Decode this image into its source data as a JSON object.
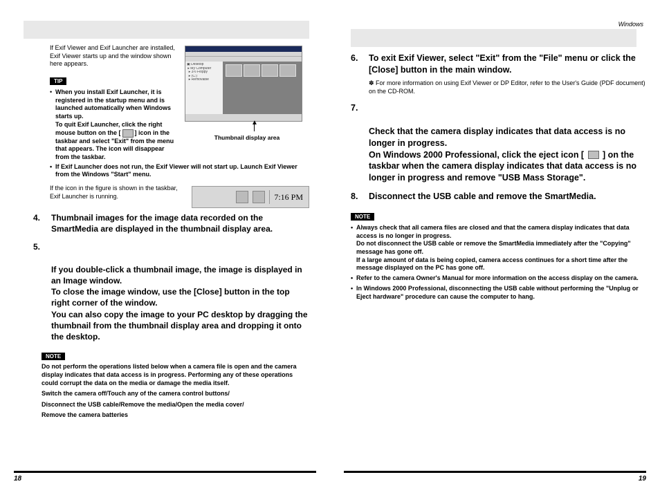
{
  "header": {
    "right_label": "Windows"
  },
  "left_page": {
    "intro": "If Exif Viewer and Exif Launcher are installed, Exif Viewer starts up and the window shown here appears.",
    "thumb_caption": "Thumbnail display area",
    "tip_label": "TIP",
    "tips": [
      {
        "line1": "When you install Exif Launcher, it is registered in the startup menu and is launched automatically when Windows starts up.",
        "line2": "To quit Exif Launcher, click the right mouse button on the [",
        "line2_after": "] icon in the taskbar and select \"Exit\" from the menu that appears. The icon will disappear from the taskbar."
      },
      {
        "line1": "If Exif Launcher does not run, the Exif Viewer will not start up. Launch Exif Viewer from the Windows \"Start\" menu."
      }
    ],
    "icon_note": "If the icon in the figure is shown in the taskbar, Exif Launcher is running.",
    "taskbar_time": "7:16 PM",
    "steps": [
      {
        "num": "4.",
        "text": "Thumbnail images for the image data recorded on the SmartMedia are displayed in the thumbnail display area."
      },
      {
        "num": "5.",
        "text": "If you double-click a thumbnail image, the image is displayed in an Image window.\nTo close the image window, use the [Close] button in the top right corner of the window.\nYou can also copy the image to your PC desktop by dragging the thumbnail from the thumbnail display area and dropping it onto the desktop."
      }
    ],
    "note_label": "NOTE",
    "note_lines": [
      "Do not perform the operations listed below when a camera file is open and the camera display indicates that data access is in progress. Performing any of these operations could corrupt the data on the media or damage the media itself.",
      "Switch the camera off/Touch any of the camera control buttons/",
      "Disconnect the USB cable/Remove the media/Open the media cover/",
      "Remove the camera batteries"
    ],
    "page_number": "18"
  },
  "right_page": {
    "steps": [
      {
        "num": "6.",
        "text": "To exit Exif Viewer, select \"Exit\" from the \"File\" menu or click the [Close] button in the main window.",
        "sub": "✽ For more information on using Exif Viewer or DP Editor, refer to the User's Guide (PDF document) on the CD-ROM."
      },
      {
        "num": "7.",
        "text_before": "Check that the camera display indicates that data access is no longer in progress.\nOn Windows 2000 Professional, click the eject icon [ ",
        "text_after": " ] on the taskbar when the camera display indicates that data access is no longer in progress and remove \"USB Mass Storage\"."
      },
      {
        "num": "8.",
        "text": "Disconnect the USB cable and remove the SmartMedia."
      }
    ],
    "note_label": "NOTE",
    "note_bullets": [
      "Always check that all camera files are closed and that the camera display indicates that data access is no longer in progress.\nDo not disconnect the USB cable or remove the SmartMedia immediately after the \"Copying\" message has gone off.\nIf a large amount of data is being copied, camera access continues for a short time after the message displayed on the PC has gone off.",
      "Refer to the camera Owner's Manual for more information on the access display on the camera.",
      "In Windows 2000 Professional, disconnecting the USB cable without performing the \"Unplug or Eject hardware\" procedure can cause the computer to hang."
    ],
    "page_number": "19"
  }
}
